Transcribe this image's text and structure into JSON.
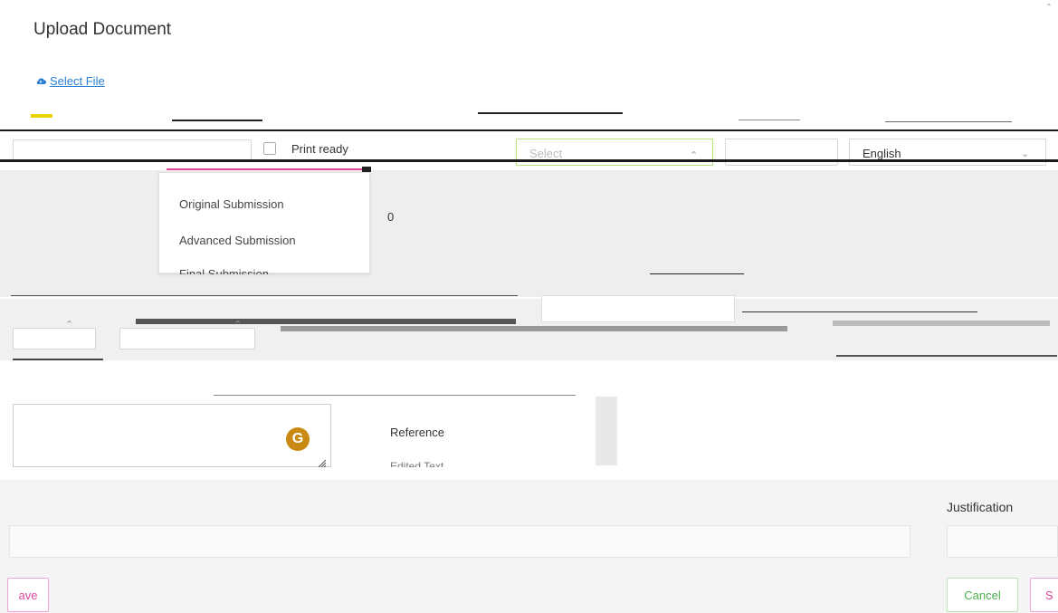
{
  "modal": {
    "title": "Upload Document",
    "close_icon": "close-icon"
  },
  "upload": {
    "select_file_label": " Select File",
    "icon": "cloud-upload-icon"
  },
  "form": {
    "print_ready_label": "Print ready",
    "select_placeholder": "Select",
    "language_value": "English",
    "count_value": "0"
  },
  "submission_dropdown": {
    "items": [
      "Original Submission",
      "Advanced Submission",
      "Final Submission"
    ]
  },
  "type_dropdown": {
    "items": [
      "Reference",
      "Edited Text"
    ]
  },
  "bottom": {
    "justification_label": "Justification",
    "save_label": "ave",
    "cancel_label": "Cancel",
    "submit_label": "S"
  },
  "colors": {
    "link": "#2a7fd4",
    "save_border": "#f0a4d8",
    "cancel_border": "#b6e7b0",
    "grammarly": "#c98a14"
  }
}
